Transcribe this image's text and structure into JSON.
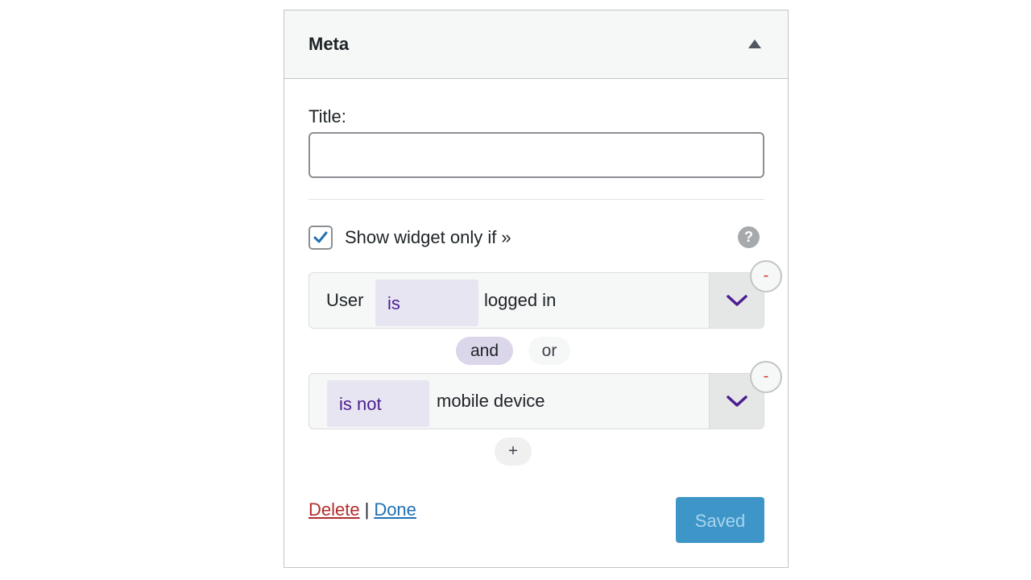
{
  "widget": {
    "title": "Meta",
    "toggle_icon": "triangle-up-icon"
  },
  "form": {
    "title_label": "Title:",
    "title_value": "",
    "title_placeholder": ""
  },
  "visibility": {
    "checked": true,
    "label": "Show widget only if »",
    "help_icon": "?"
  },
  "rules": [
    {
      "subject": "User",
      "operator": "is",
      "value": "logged in",
      "remove_label": "-"
    },
    {
      "subject": "",
      "operator": "is not",
      "value": "mobile device",
      "remove_label": "-"
    }
  ],
  "conjunctions": {
    "and": "and",
    "or": "or",
    "selected": "and"
  },
  "add_rule_label": "+",
  "footer": {
    "delete": "Delete",
    "separator": "|",
    "done": "Done",
    "saved": "Saved"
  },
  "colors": {
    "operator_text": "#4b1d8f",
    "operator_bg": "#e7e5f1",
    "saved_button": "#3e96c8",
    "delete_link": "#b32d2e",
    "done_link": "#2271b1"
  }
}
